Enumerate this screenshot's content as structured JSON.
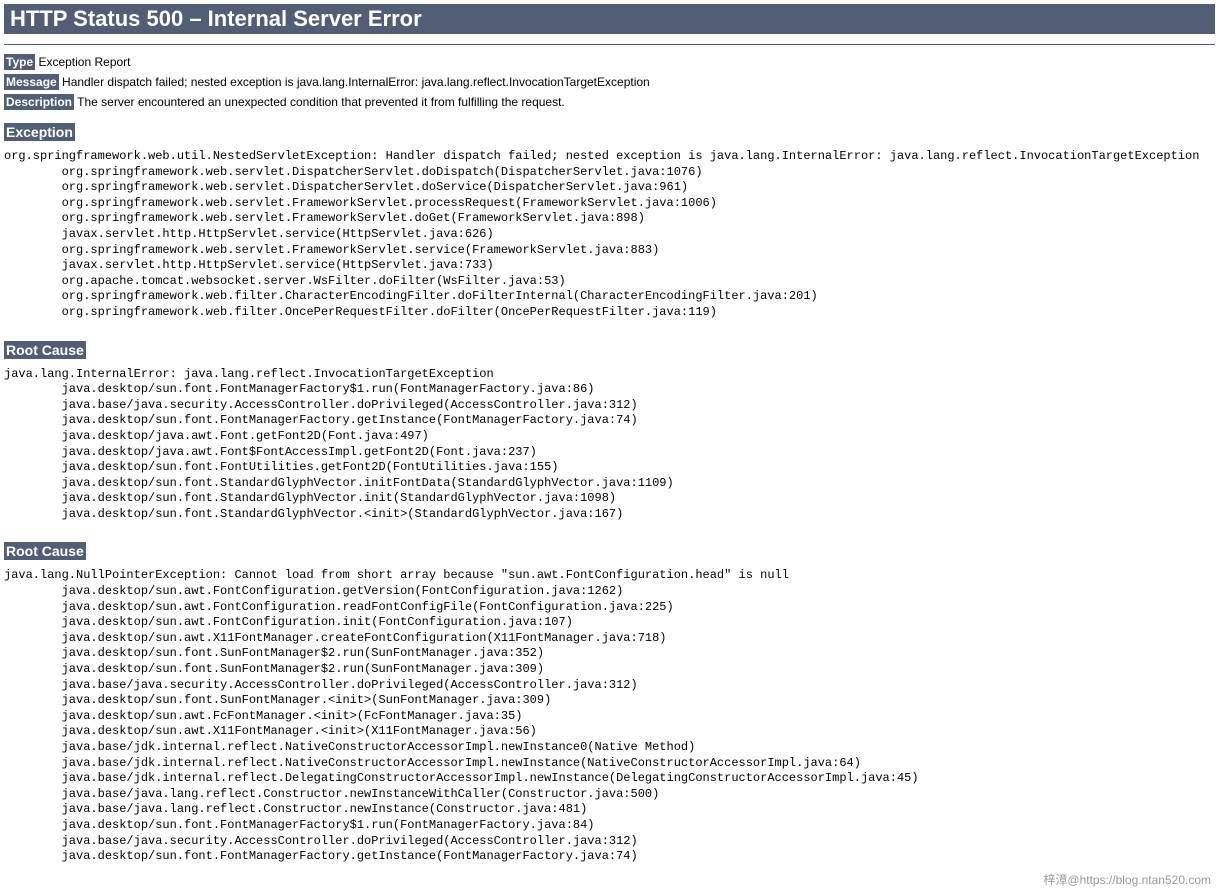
{
  "title": "HTTP Status 500 – Internal Server Error",
  "labels": {
    "type": "Type",
    "type_value": " Exception Report",
    "message": "Message",
    "message_value": " Handler dispatch failed; nested exception is java.lang.InternalError: java.lang.reflect.InvocationTargetException",
    "description": "Description",
    "description_value": " The server encountered an unexpected condition that prevented it from fulfilling the request."
  },
  "sections": {
    "exception": "Exception",
    "root1": "Root Cause",
    "root2": "Root Cause"
  },
  "exception_trace": "org.springframework.web.util.NestedServletException: Handler dispatch failed; nested exception is java.lang.InternalError: java.lang.reflect.InvocationTargetException\n        org.springframework.web.servlet.DispatcherServlet.doDispatch(DispatcherServlet.java:1076)\n        org.springframework.web.servlet.DispatcherServlet.doService(DispatcherServlet.java:961)\n        org.springframework.web.servlet.FrameworkServlet.processRequest(FrameworkServlet.java:1006)\n        org.springframework.web.servlet.FrameworkServlet.doGet(FrameworkServlet.java:898)\n        javax.servlet.http.HttpServlet.service(HttpServlet.java:626)\n        org.springframework.web.servlet.FrameworkServlet.service(FrameworkServlet.java:883)\n        javax.servlet.http.HttpServlet.service(HttpServlet.java:733)\n        org.apache.tomcat.websocket.server.WsFilter.doFilter(WsFilter.java:53)\n        org.springframework.web.filter.CharacterEncodingFilter.doFilterInternal(CharacterEncodingFilter.java:201)\n        org.springframework.web.filter.OncePerRequestFilter.doFilter(OncePerRequestFilter.java:119)",
  "root1_trace": "java.lang.InternalError: java.lang.reflect.InvocationTargetException\n        java.desktop/sun.font.FontManagerFactory$1.run(FontManagerFactory.java:86)\n        java.base/java.security.AccessController.doPrivileged(AccessController.java:312)\n        java.desktop/sun.font.FontManagerFactory.getInstance(FontManagerFactory.java:74)\n        java.desktop/java.awt.Font.getFont2D(Font.java:497)\n        java.desktop/java.awt.Font$FontAccessImpl.getFont2D(Font.java:237)\n        java.desktop/sun.font.FontUtilities.getFont2D(FontUtilities.java:155)\n        java.desktop/sun.font.StandardGlyphVector.initFontData(StandardGlyphVector.java:1109)\n        java.desktop/sun.font.StandardGlyphVector.init(StandardGlyphVector.java:1098)\n        java.desktop/sun.font.StandardGlyphVector.<init>(StandardGlyphVector.java:167)",
  "root2_trace": "java.lang.NullPointerException: Cannot load from short array because \"sun.awt.FontConfiguration.head\" is null\n        java.desktop/sun.awt.FontConfiguration.getVersion(FontConfiguration.java:1262)\n        java.desktop/sun.awt.FontConfiguration.readFontConfigFile(FontConfiguration.java:225)\n        java.desktop/sun.awt.FontConfiguration.init(FontConfiguration.java:107)\n        java.desktop/sun.awt.X11FontManager.createFontConfiguration(X11FontManager.java:718)\n        java.desktop/sun.font.SunFontManager$2.run(SunFontManager.java:352)\n        java.desktop/sun.font.SunFontManager$2.run(SunFontManager.java:309)\n        java.base/java.security.AccessController.doPrivileged(AccessController.java:312)\n        java.desktop/sun.font.SunFontManager.<init>(SunFontManager.java:309)\n        java.desktop/sun.awt.FcFontManager.<init>(FcFontManager.java:35)\n        java.desktop/sun.awt.X11FontManager.<init>(X11FontManager.java:56)\n        java.base/jdk.internal.reflect.NativeConstructorAccessorImpl.newInstance0(Native Method)\n        java.base/jdk.internal.reflect.NativeConstructorAccessorImpl.newInstance(NativeConstructorAccessorImpl.java:64)\n        java.base/jdk.internal.reflect.DelegatingConstructorAccessorImpl.newInstance(DelegatingConstructorAccessorImpl.java:45)\n        java.base/java.lang.reflect.Constructor.newInstanceWithCaller(Constructor.java:500)\n        java.base/java.lang.reflect.Constructor.newInstance(Constructor.java:481)\n        java.desktop/sun.font.FontManagerFactory$1.run(FontManagerFactory.java:84)\n        java.base/java.security.AccessController.doPrivileged(AccessController.java:312)\n        java.desktop/sun.font.FontManagerFactory.getInstance(FontManagerFactory.java:74)",
  "watermark": "梓漳@https://blog.ntan520.com"
}
